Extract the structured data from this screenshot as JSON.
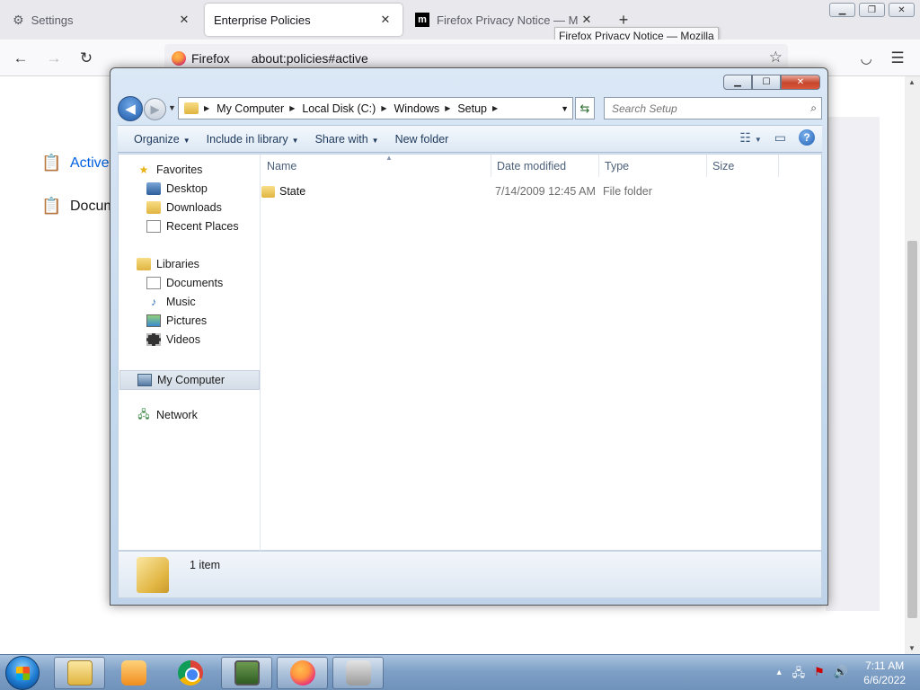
{
  "browser": {
    "tabs": [
      {
        "label": "Settings",
        "icon": "gear-icon"
      },
      {
        "label": "Enterprise Policies",
        "icon": ""
      },
      {
        "label": "Firefox Privacy Notice — Mozill",
        "icon": "mozilla-m-icon"
      }
    ],
    "tooltip": "Firefox Privacy Notice — Mozilla",
    "identity_label": "Firefox",
    "url": "about:policies#active",
    "page": {
      "links": [
        "Active",
        "Docum"
      ]
    }
  },
  "explorer": {
    "breadcrumb": [
      "My Computer",
      "Local Disk (C:)",
      "Windows",
      "Setup"
    ],
    "search_placeholder": "Search Setup",
    "toolbar": {
      "organize": "Organize",
      "include_in_library": "Include in library",
      "share_with": "Share with",
      "new_folder": "New folder"
    },
    "nav": {
      "favorites": "Favorites",
      "desktop": "Desktop",
      "downloads": "Downloads",
      "recent_places": "Recent Places",
      "libraries": "Libraries",
      "documents": "Documents",
      "music": "Music",
      "pictures": "Pictures",
      "videos": "Videos",
      "my_computer": "My Computer",
      "network": "Network"
    },
    "columns": {
      "name": "Name",
      "date_modified": "Date modified",
      "type": "Type",
      "size": "Size"
    },
    "files": [
      {
        "name": "State",
        "date_modified": "7/14/2009 12:45 AM",
        "type": "File folder",
        "size": ""
      }
    ],
    "status": "1 item"
  },
  "taskbar": {
    "time": "7:11 AM",
    "date": "6/6/2022"
  },
  "colors": {
    "accent": "#0061e0",
    "window_frame": "#c5d9ee",
    "taskbar": "#7fa0c6"
  }
}
